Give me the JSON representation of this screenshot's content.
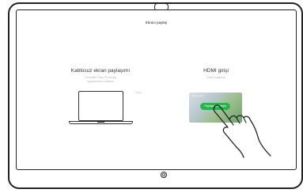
{
  "screen": {
    "title": "Ekranı paylaş"
  },
  "wireless": {
    "title": "Kablosuz ekran paylaşımı",
    "subtitle_line1": "Otomatik Cisco Proximity",
    "subtitle_line2": "uygulamasını kullanın"
  },
  "divider_text": "veya",
  "hdmi": {
    "title": "HDMI girişi",
    "subtitle": "Cihaz bağlandı",
    "preview_caption": "Sunum hazır",
    "share_button_label": "Paylaşmaya başla"
  },
  "icons": {
    "laptop": "laptop-icon",
    "hand": "hand-pointer-icon",
    "camera": "camera-icon",
    "home": "home-button-icon"
  },
  "colors": {
    "share_button": "#2bb24c",
    "frame": "#222222",
    "muted_text": "#b5b5b5"
  }
}
